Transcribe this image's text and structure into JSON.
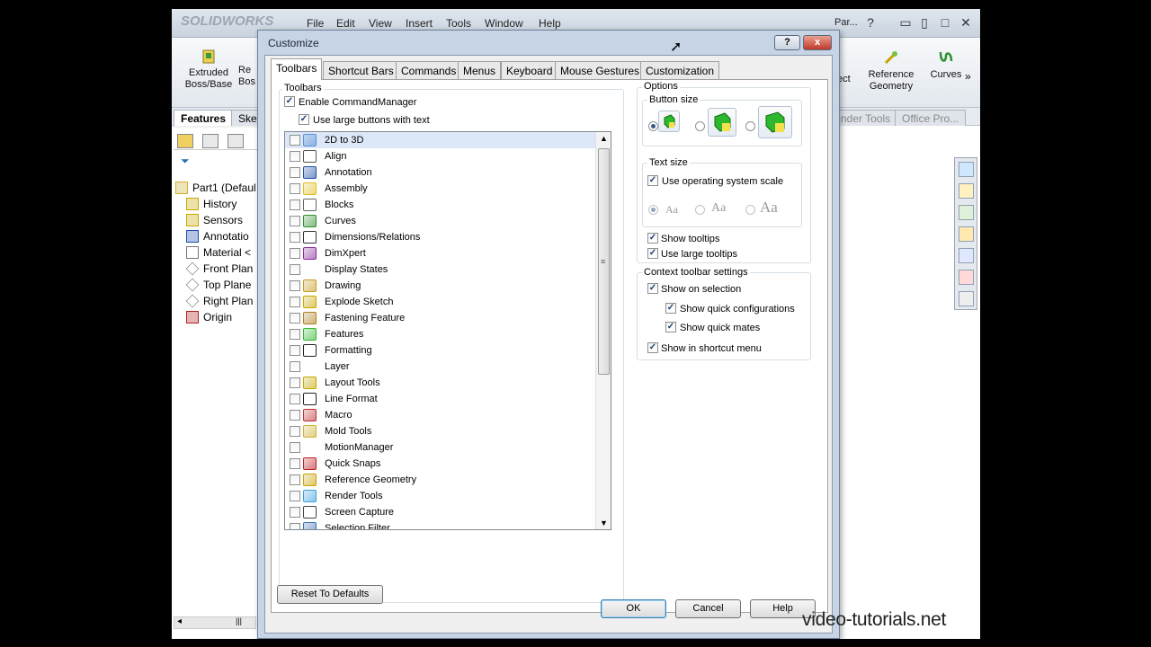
{
  "app": {
    "logo": "SOLIDWORKS",
    "menu": [
      "File",
      "Edit",
      "View",
      "Insert",
      "Tools",
      "Window",
      "Help"
    ],
    "doc_title": "Par...",
    "ribbon": {
      "extruded": "Extruded Boss/Base",
      "revolved": "Re Bos",
      "select": "ect",
      "reference_geometry": "Reference Geometry",
      "curves": "Curves"
    },
    "feature_tabs": {
      "features": "Features",
      "sketch": "Ske"
    },
    "right_tabs": {
      "render_tools": "nder Tools",
      "office": "Office Pro..."
    },
    "tree": [
      {
        "label": "Part1  (Defaul",
        "icon": "part-icon"
      },
      {
        "label": "History",
        "icon": "history-icon"
      },
      {
        "label": "Sensors",
        "icon": "sensors-icon"
      },
      {
        "label": "Annotatio",
        "icon": "annotation-icon"
      },
      {
        "label": "Material <",
        "icon": "material-icon"
      },
      {
        "label": "Front Plan",
        "icon": "plane-icon"
      },
      {
        "label": "Top Plane",
        "icon": "plane-icon"
      },
      {
        "label": "Right Plan",
        "icon": "plane-icon"
      },
      {
        "label": "Origin",
        "icon": "origin-icon"
      }
    ]
  },
  "dialog": {
    "title": "Customize",
    "title_help": "?",
    "title_close": "x",
    "tabs": [
      "Toolbars",
      "Shortcut Bars",
      "Commands",
      "Menus",
      "Keyboard",
      "Mouse Gestures",
      "Customization"
    ],
    "active_tab": "Toolbars",
    "toolbars_group": "Toolbars",
    "enable_commandmanager": "Enable CommandManager",
    "use_large_buttons": "Use large buttons with text",
    "toolbar_list": [
      {
        "label": "2D to 3D",
        "checked": false,
        "icon": "2d-to-3d-icon"
      },
      {
        "label": "Align",
        "checked": false,
        "icon": "align-icon"
      },
      {
        "label": "Annotation",
        "checked": false,
        "icon": "annotation-icon"
      },
      {
        "label": "Assembly",
        "checked": false,
        "icon": "assembly-icon"
      },
      {
        "label": "Blocks",
        "checked": false,
        "icon": "blocks-icon"
      },
      {
        "label": "Curves",
        "checked": false,
        "icon": "curves-icon"
      },
      {
        "label": "Dimensions/Relations",
        "checked": false,
        "icon": "dimensions-icon"
      },
      {
        "label": "DimXpert",
        "checked": false,
        "icon": "dimxpert-icon"
      },
      {
        "label": "Display States",
        "checked": false,
        "icon": ""
      },
      {
        "label": "Drawing",
        "checked": false,
        "icon": "drawing-icon"
      },
      {
        "label": "Explode Sketch",
        "checked": false,
        "icon": "explode-sketch-icon"
      },
      {
        "label": "Fastening Feature",
        "checked": false,
        "icon": "fastening-icon"
      },
      {
        "label": "Features",
        "checked": false,
        "icon": "features-icon"
      },
      {
        "label": "Formatting",
        "checked": false,
        "icon": "formatting-icon"
      },
      {
        "label": "Layer",
        "checked": false,
        "icon": ""
      },
      {
        "label": "Layout Tools",
        "checked": false,
        "icon": "layout-tools-icon"
      },
      {
        "label": "Line Format",
        "checked": false,
        "icon": "line-format-icon"
      },
      {
        "label": "Macro",
        "checked": false,
        "icon": "macro-icon"
      },
      {
        "label": "Mold Tools",
        "checked": false,
        "icon": "mold-tools-icon"
      },
      {
        "label": "MotionManager",
        "checked": false,
        "icon": ""
      },
      {
        "label": "Quick Snaps",
        "checked": false,
        "icon": "quick-snaps-icon"
      },
      {
        "label": "Reference Geometry",
        "checked": false,
        "icon": "reference-geometry-icon"
      },
      {
        "label": "Render Tools",
        "checked": false,
        "icon": "render-tools-icon"
      },
      {
        "label": "Screen Capture",
        "checked": false,
        "icon": "screen-capture-icon"
      },
      {
        "label": "Selection Filter",
        "checked": false,
        "icon": "selection-filter-icon"
      }
    ],
    "options_group": "Options",
    "button_size": "Button size",
    "text_size": "Text size",
    "use_os_scale": "Use operating system scale",
    "aa": "Aa",
    "show_tooltips": "Show tooltips",
    "use_large_tooltips": "Use large tooltips",
    "context_group": "Context toolbar settings",
    "show_on_selection": "Show on selection",
    "show_quick_configs": "Show quick configurations",
    "show_quick_mates": "Show quick mates",
    "show_in_shortcut": "Show in shortcut menu",
    "reset": "Reset To Defaults",
    "ok": "OK",
    "cancel": "Cancel",
    "help": "Help"
  },
  "watermark": "video-tutorials.net"
}
